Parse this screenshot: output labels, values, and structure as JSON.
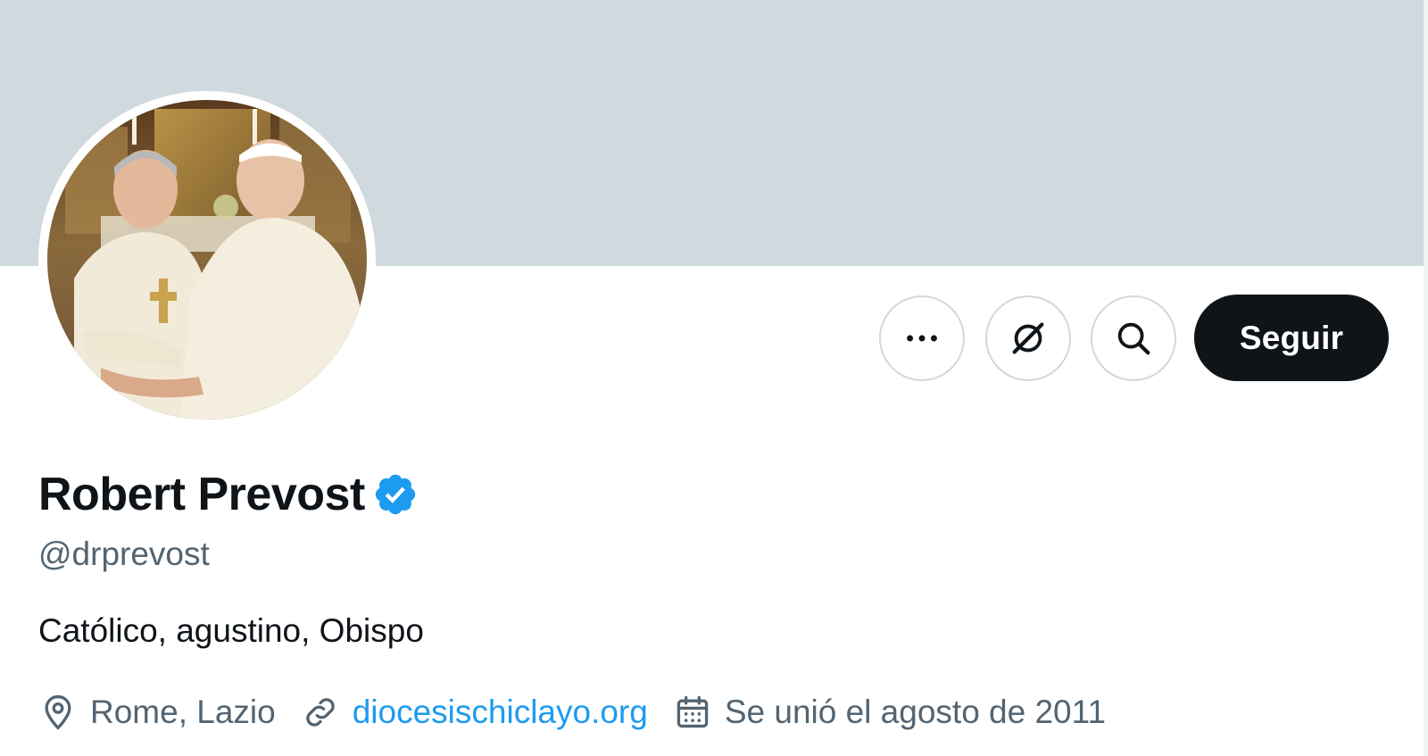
{
  "profile": {
    "name": "Robert Prevost",
    "handle": "@drprevost",
    "bio": "Católico, agustino, Obispo",
    "location": "Rome, Lazio",
    "website": "diocesischiclayo.org",
    "joined": "Se unió el agosto de 2011",
    "verified": true
  },
  "actions": {
    "follow_label": "Seguir"
  },
  "icons": {
    "more": "more-horizontal-icon",
    "grok": "grok-icon",
    "search": "search-icon",
    "verified": "verified-badge-icon",
    "location": "location-pin-icon",
    "link": "link-icon",
    "calendar": "calendar-icon"
  },
  "colors": {
    "banner": "#cfd9de",
    "text_primary": "#0f1419",
    "text_secondary": "#536471",
    "accent": "#1d9bf0",
    "follow_button": "#0f1419"
  }
}
